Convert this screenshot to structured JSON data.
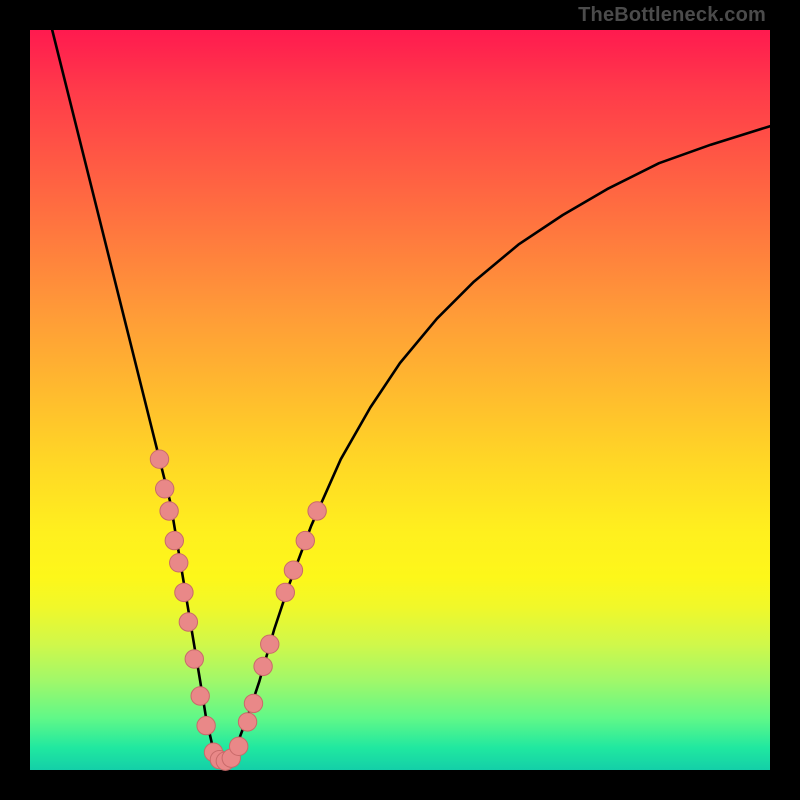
{
  "attribution": "TheBottleneck.com",
  "colors": {
    "background": "#000000",
    "curve": "#000000",
    "marker_fill": "#e98888",
    "marker_stroke": "#c96a6a",
    "gradient_stops": [
      "#ff1a4f",
      "#ff3a4a",
      "#ff5a44",
      "#ff7a3e",
      "#ff9a38",
      "#ffb82f",
      "#ffd626",
      "#fff01e",
      "#fdf71a",
      "#f0f82a",
      "#d0f84a",
      "#a0f86a",
      "#60f888",
      "#20e8a0",
      "#14cfa8"
    ]
  },
  "chart_data": {
    "type": "line",
    "title": "",
    "xlabel": "",
    "ylabel": "",
    "xlim": [
      0,
      100
    ],
    "ylim": [
      0,
      100
    ],
    "grid": false,
    "legend": false,
    "series": [
      {
        "name": "bottleneck-curve",
        "x": [
          3,
          5,
          7,
          9,
          11,
          13,
          15,
          17,
          19,
          20,
          21,
          22,
          23,
          23.8,
          24.6,
          25.4,
          26.2,
          27,
          28,
          29.5,
          31,
          33,
          35,
          38,
          42,
          46,
          50,
          55,
          60,
          66,
          72,
          78,
          85,
          92,
          100
        ],
        "y": [
          100,
          92,
          84,
          76,
          68,
          60,
          52,
          44,
          36,
          30,
          24,
          18,
          12,
          7,
          3.5,
          1.4,
          1.0,
          1.4,
          3.5,
          7.5,
          12,
          19,
          25,
          33,
          42,
          49,
          55,
          61,
          66,
          71,
          75,
          78.5,
          82,
          84.5,
          87
        ]
      }
    ],
    "markers": [
      {
        "name": "left-cluster",
        "x": 17.5,
        "y": 42
      },
      {
        "name": "left-cluster",
        "x": 18.2,
        "y": 38
      },
      {
        "name": "left-cluster",
        "x": 18.8,
        "y": 35
      },
      {
        "name": "left-cluster",
        "x": 19.5,
        "y": 31
      },
      {
        "name": "left-cluster",
        "x": 20.1,
        "y": 28
      },
      {
        "name": "left-cluster",
        "x": 20.8,
        "y": 24
      },
      {
        "name": "left-cluster",
        "x": 21.4,
        "y": 20
      },
      {
        "name": "left-cluster",
        "x": 22.2,
        "y": 15
      },
      {
        "name": "left-cluster",
        "x": 23.0,
        "y": 10
      },
      {
        "name": "left-cluster",
        "x": 23.8,
        "y": 6
      },
      {
        "name": "bottom",
        "x": 24.8,
        "y": 2.4
      },
      {
        "name": "bottom",
        "x": 25.6,
        "y": 1.4
      },
      {
        "name": "bottom",
        "x": 26.4,
        "y": 1.2
      },
      {
        "name": "bottom",
        "x": 27.2,
        "y": 1.6
      },
      {
        "name": "bottom",
        "x": 28.2,
        "y": 3.2
      },
      {
        "name": "right-cluster",
        "x": 29.4,
        "y": 6.5
      },
      {
        "name": "right-cluster",
        "x": 30.2,
        "y": 9
      },
      {
        "name": "right-cluster",
        "x": 31.5,
        "y": 14
      },
      {
        "name": "right-cluster",
        "x": 32.4,
        "y": 17
      },
      {
        "name": "right-cluster",
        "x": 34.5,
        "y": 24
      },
      {
        "name": "right-cluster",
        "x": 35.6,
        "y": 27
      },
      {
        "name": "right-cluster",
        "x": 37.2,
        "y": 31
      },
      {
        "name": "right-cluster",
        "x": 38.8,
        "y": 35
      }
    ]
  }
}
